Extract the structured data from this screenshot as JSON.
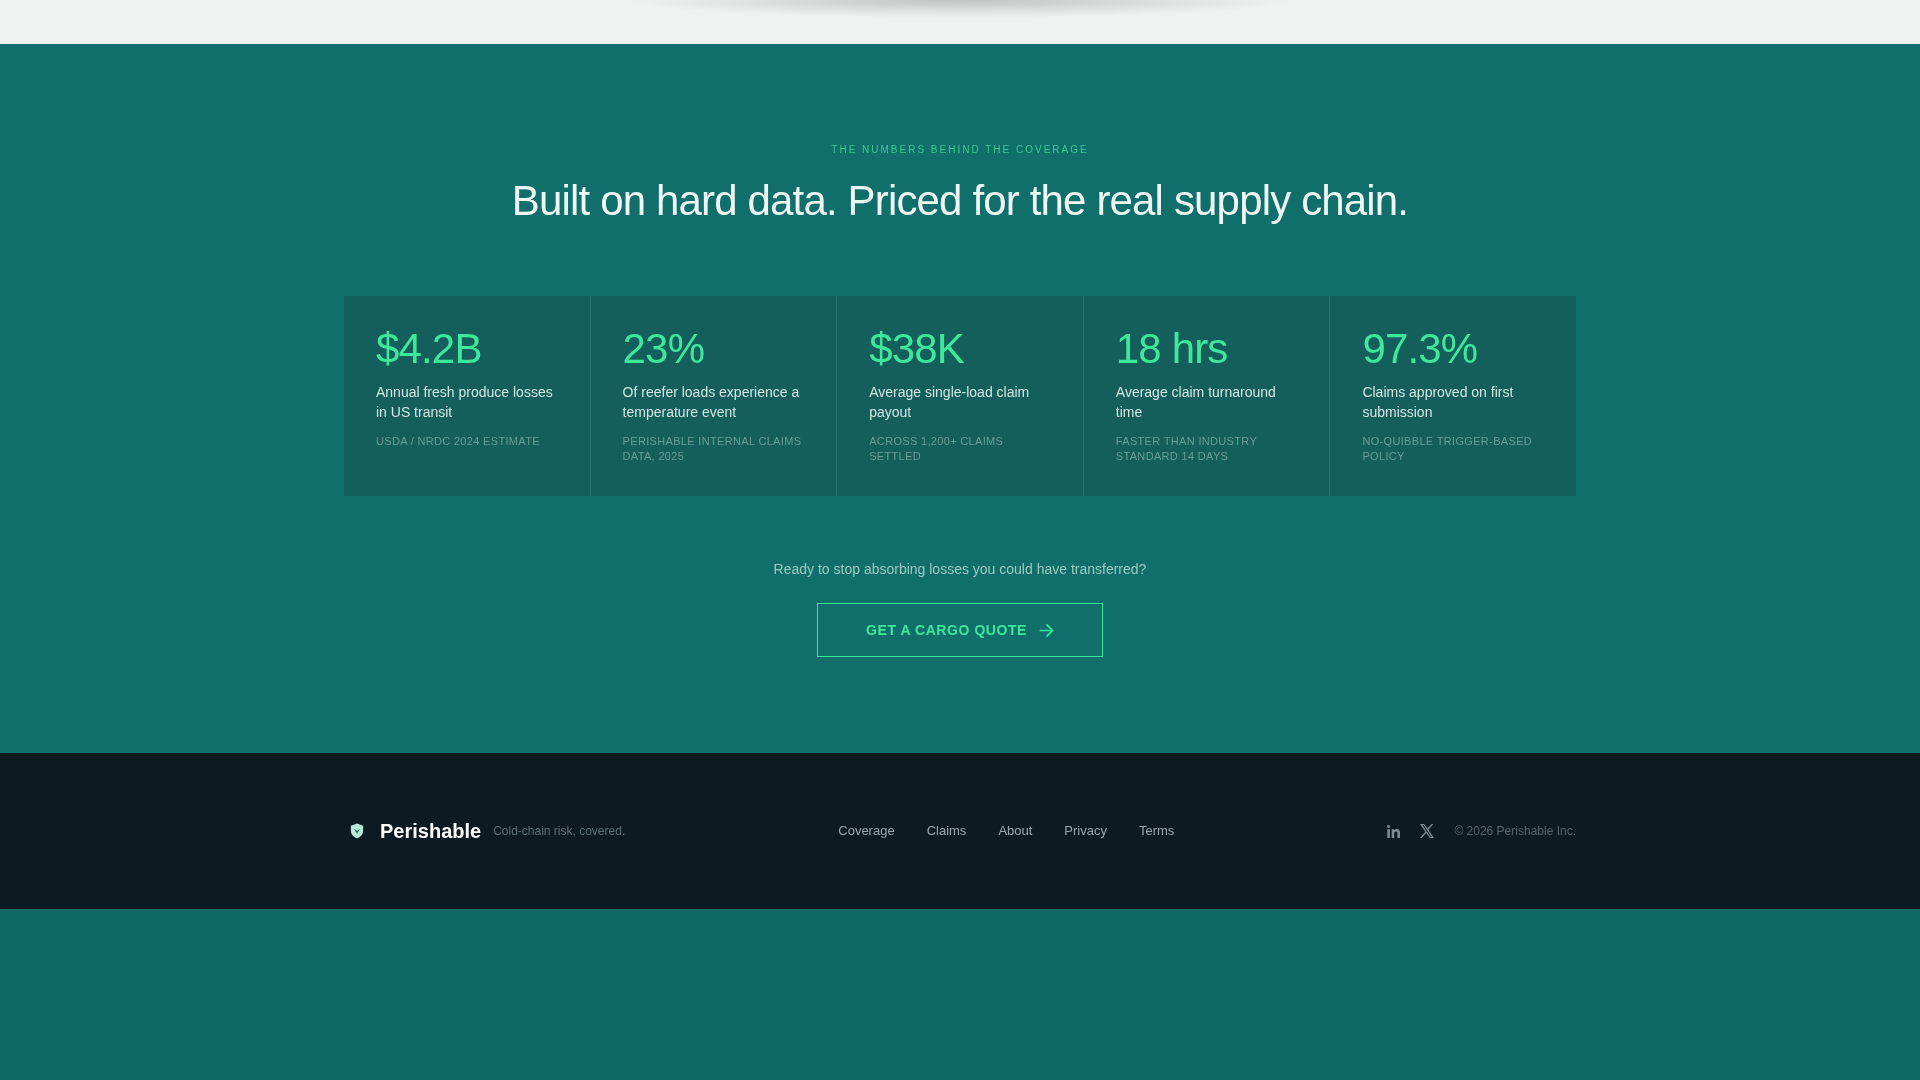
{
  "stats_section": {
    "eyebrow": "THE NUMBERS BEHIND THE COVERAGE",
    "heading": "Built on hard data. Priced for the real supply chain.",
    "stats": [
      {
        "value": "$4.2B",
        "description": "Annual fresh produce losses in US transit",
        "source": "USDA / NRDC 2024 ESTIMATE"
      },
      {
        "value": "23%",
        "description": "Of reefer loads experience a temperature event",
        "source": "PERISHABLE INTERNAL CLAIMS DATA, 2025"
      },
      {
        "value": "$38K",
        "description": "Average single-load claim payout",
        "source": "ACROSS 1,200+ CLAIMS SETTLED"
      },
      {
        "value": "18 hrs",
        "description": "Average claim turnaround time",
        "source": "FASTER THAN INDUSTRY STANDARD 14 DAYS"
      },
      {
        "value": "97.3%",
        "description": "Claims approved on first submission",
        "source": "NO-QUIBBLE TRIGGER-BASED POLICY"
      }
    ],
    "cta": {
      "prompt": "Ready to stop absorbing losses you could have transferred?",
      "button": "GET A CARGO QUOTE"
    }
  },
  "footer": {
    "brand": {
      "name": "Perishable",
      "tagline": "Cold-chain risk, covered."
    },
    "links": [
      "Coverage",
      "Claims",
      "About",
      "Privacy",
      "Terms"
    ],
    "copyright": "© 2026 Perishable Inc."
  }
}
